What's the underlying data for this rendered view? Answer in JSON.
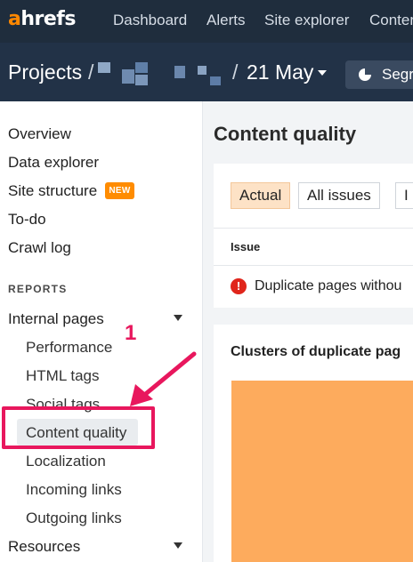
{
  "topnav": {
    "logo_accent": "a",
    "logo_rest": "hrefs",
    "items": [
      "Dashboard",
      "Alerts",
      "Site explorer",
      "Conter"
    ]
  },
  "project_bar": {
    "title": "Projects",
    "slash": "/",
    "date": "21 May",
    "segments_label": "Segr"
  },
  "sidebar": {
    "overview": "Overview",
    "data_explorer": "Data explorer",
    "site_structure": "Site structure",
    "new_badge": "NEW",
    "todo": "To-do",
    "crawl_log": "Crawl log",
    "reports_heading": "REPORTS",
    "internal_pages": "Internal pages",
    "sub": [
      "Performance",
      "HTML tags",
      "Social tags",
      "Content quality",
      "Localization",
      "Incoming links",
      "Outgoing links"
    ],
    "resources": "Resources"
  },
  "main": {
    "title": "Content quality",
    "tabs": [
      "Actual",
      "All issues",
      "I"
    ],
    "column_issue": "Issue",
    "issue_row": "Duplicate pages withou",
    "error_glyph": "!",
    "card2_title": "Clusters of duplicate pag"
  },
  "annotation": {
    "number": "1"
  },
  "colors": {
    "accent": "#ff8800",
    "highlight": "#e8175d",
    "active_tab": "#fde2c6",
    "chart_block": "#fdab5d"
  }
}
